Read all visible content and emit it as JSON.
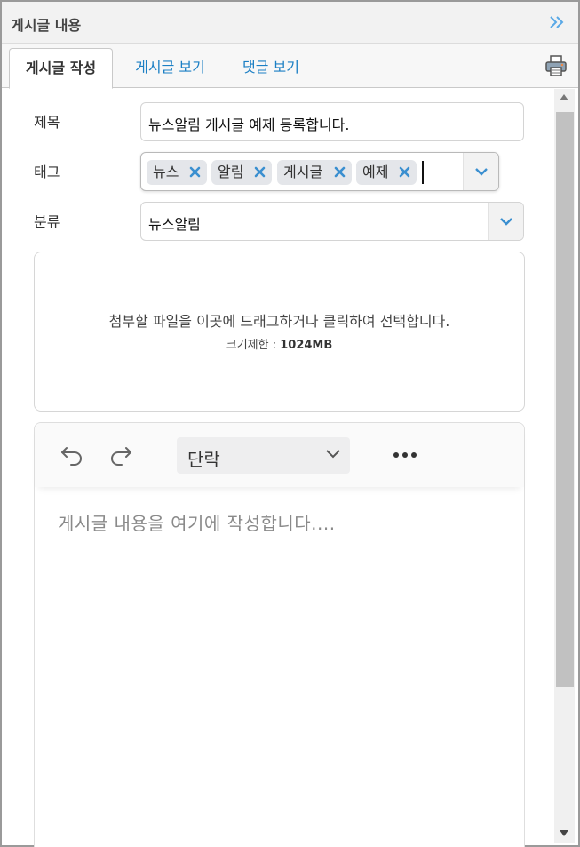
{
  "window": {
    "title": "게시글 내용",
    "collapse_icon": "double-chevron-right-icon"
  },
  "tabs": [
    {
      "label": "게시글 작성",
      "active": true
    },
    {
      "label": "게시글 보기",
      "active": false
    },
    {
      "label": "댓글 보기",
      "active": false
    }
  ],
  "print_icon": "printer-icon",
  "form": {
    "title_label": "제목",
    "title_value": "뉴스알림 게시글 예제 등록합니다.",
    "tag_label": "태그",
    "tags": [
      "뉴스",
      "알림",
      "게시글",
      "예제"
    ],
    "category_label": "분류",
    "category_value": "뉴스알림"
  },
  "upload": {
    "hint": "첨부할 파일을 이곳에 드래그하거나 클릭하여 선택합니다.",
    "limit_label": "크기제한 : ",
    "limit_value": "1024MB"
  },
  "editor": {
    "block_format": "단락",
    "placeholder": "게시글 내용을 여기에 작성합니다...."
  },
  "colors": {
    "accent": "#1b7fc4",
    "chip_bg": "#e4e6ea",
    "chip_x": "#3a8fd0"
  }
}
